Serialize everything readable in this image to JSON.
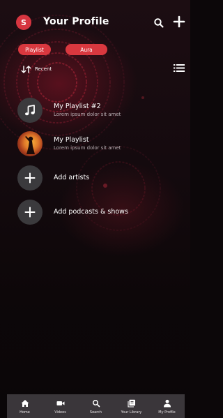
{
  "header": {
    "avatar_initial": "S",
    "title": "Your Profile",
    "search_icon": "search-icon",
    "add_icon": "plus-icon"
  },
  "filters": [
    {
      "label": "Playlist"
    },
    {
      "label": "Aura"
    }
  ],
  "sort": {
    "icon": "sort-arrows-icon",
    "label": "Recent",
    "view_icon": "list-view-icon"
  },
  "library": {
    "items": [
      {
        "title": "My Playlist #2",
        "subtitle": "Lorem ipsum dolor sit amet",
        "thumb_icon": "music-note-icon"
      },
      {
        "title": "My Playlist",
        "subtitle": "Lorem ipsum dolor sit amet",
        "thumb_icon": "cover-image"
      },
      {
        "title": "Add artists",
        "thumb_icon": "plus-icon"
      },
      {
        "title": "Add podcasts & shows",
        "thumb_icon": "plus-icon"
      }
    ]
  },
  "bottom_nav": [
    {
      "label": "Home",
      "icon": "home-icon"
    },
    {
      "label": "Videos",
      "icon": "video-camera-icon"
    },
    {
      "label": "Search",
      "icon": "search-icon"
    },
    {
      "label": "Your Library",
      "icon": "library-icon"
    },
    {
      "label": "My Profile",
      "icon": "person-icon"
    }
  ],
  "colors": {
    "accent": "#d9383f",
    "background": "#140a0e",
    "nav_background": "#3a363a",
    "thumb_background": "#3b3a3d"
  }
}
